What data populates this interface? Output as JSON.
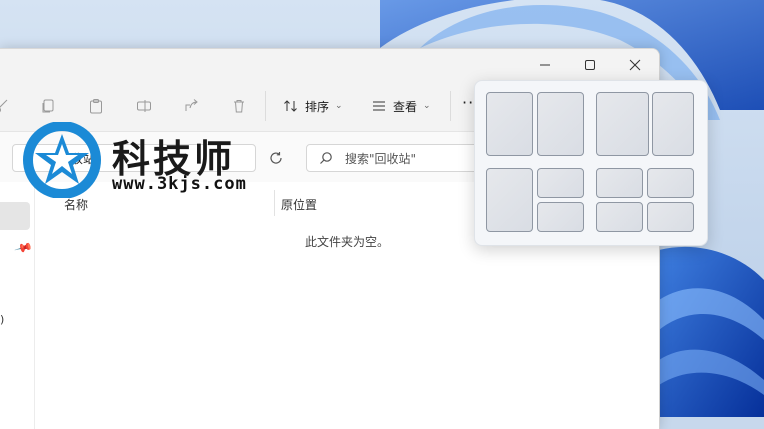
{
  "toolbar": {
    "sort_label": "排序",
    "view_label": "查看",
    "more_label": "···"
  },
  "address": {
    "path_text": "回收站",
    "search_placeholder": "搜索\"回收站\""
  },
  "nav": {
    "fragment_text": ")"
  },
  "columns": {
    "name": "名称",
    "original_location": "原位置"
  },
  "content": {
    "empty_message": "此文件夹为空。"
  },
  "watermark": {
    "brand": "科技师",
    "url": "www.3kjs.com"
  },
  "colors": {
    "accent": "#1b8ad6",
    "wallpaper_blue": "#1f5fc9"
  }
}
